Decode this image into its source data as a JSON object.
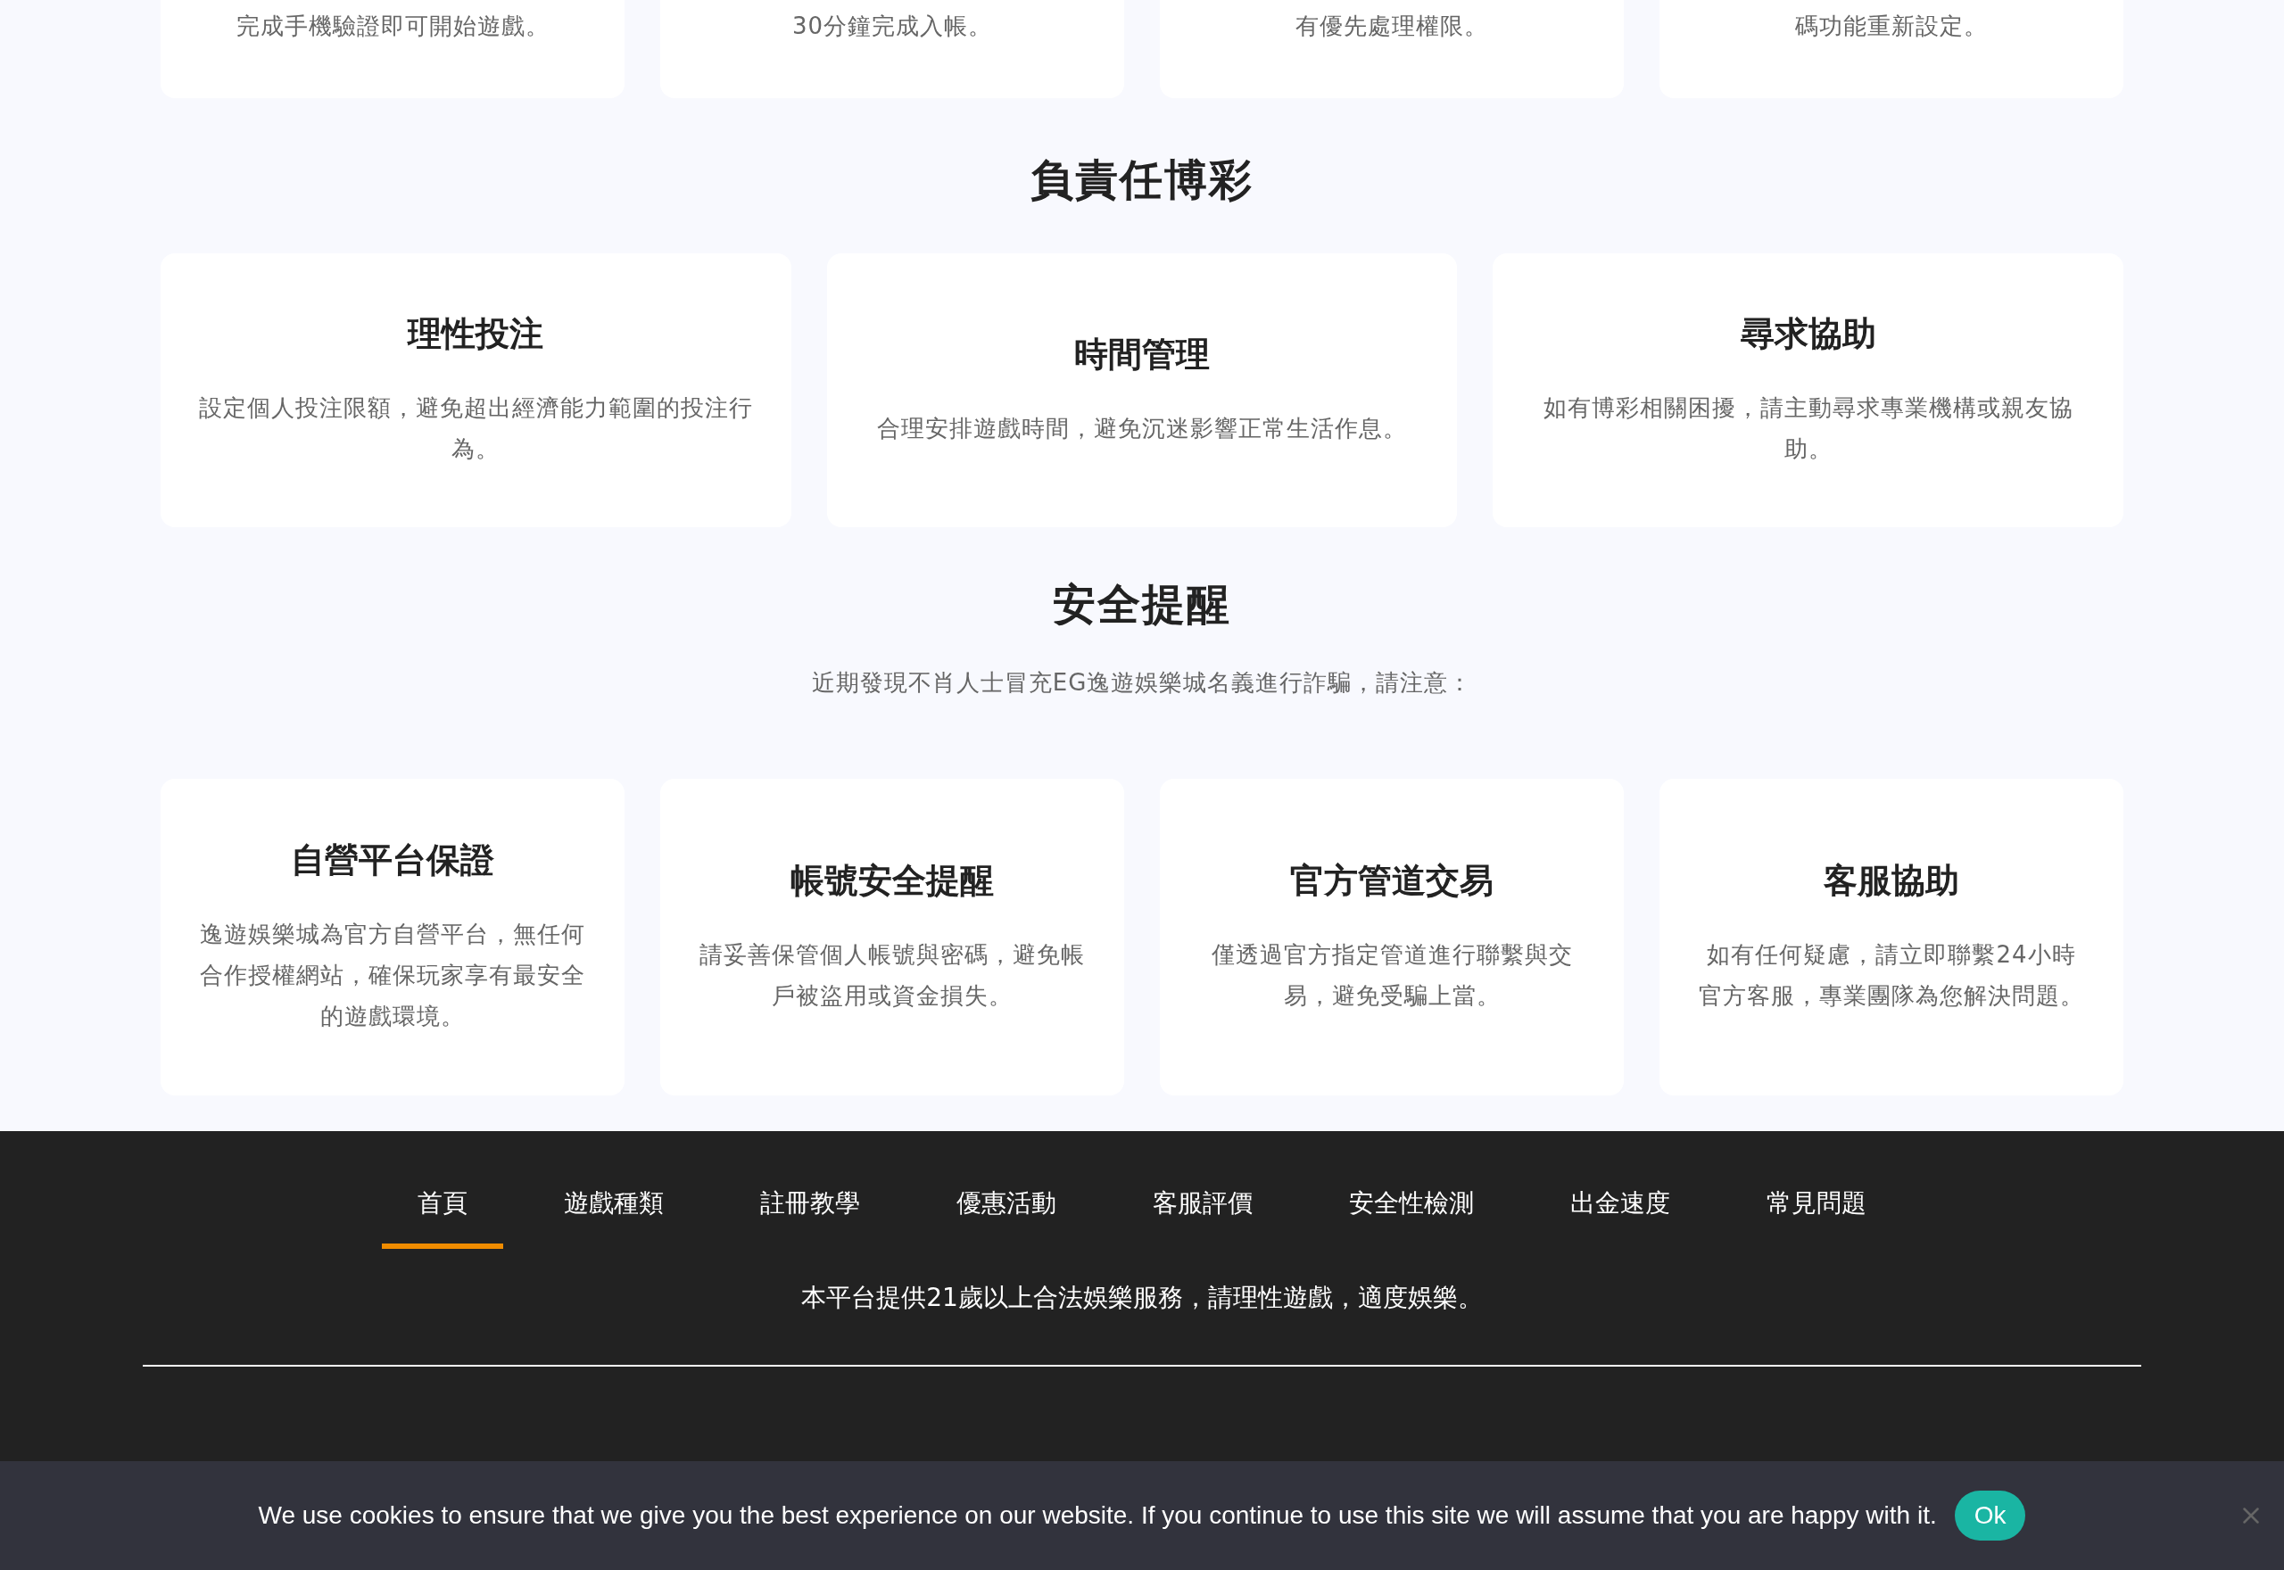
{
  "top_cards": [
    {
      "text": "完成手機驗證即可開始遊戲。"
    },
    {
      "text": "30分鐘完成入帳。"
    },
    {
      "text": "有優先處理權限。"
    },
    {
      "text": "碼功能重新設定。"
    }
  ],
  "responsible": {
    "title": "負責任博彩",
    "cards": [
      {
        "title": "理性投注",
        "text": "設定個人投注限額，避免超出經濟能力範圍的投注行為。"
      },
      {
        "title": "時間管理",
        "text": "合理安排遊戲時間，避免沉迷影響正常生活作息。"
      },
      {
        "title": "尋求協助",
        "text": "如有博彩相關困擾，請主動尋求專業機構或親友協助。"
      }
    ]
  },
  "safety": {
    "title": "安全提醒",
    "subtitle": "近期發現不肖人士冒充EG逸遊娛樂城名義進行詐騙，請注意：",
    "cards": [
      {
        "title": "自營平台保證",
        "text": "逸遊娛樂城為官方自營平台，無任何合作授權網站，確保玩家享有最安全的遊戲環境。"
      },
      {
        "title": "帳號安全提醒",
        "text": "請妥善保管個人帳號與密碼，避免帳戶被盜用或資金損失。"
      },
      {
        "title": "官方管道交易",
        "text": "僅透過官方指定管道進行聯繫與交易，避免受騙上當。"
      },
      {
        "title": "客服協助",
        "text": "如有任何疑慮，請立即聯繫24小時官方客服，專業團隊為您解決問題。"
      }
    ]
  },
  "footer": {
    "nav": [
      {
        "label": "首頁",
        "selected": true
      },
      {
        "label": "遊戲種類",
        "selected": false
      },
      {
        "label": "註冊教學",
        "selected": false
      },
      {
        "label": "優惠活動",
        "selected": false
      },
      {
        "label": "客服評價",
        "selected": false
      },
      {
        "label": "安全性檢測",
        "selected": false
      },
      {
        "label": "出金速度",
        "selected": false
      },
      {
        "label": "常見問題",
        "selected": false
      }
    ],
    "disclaimer": "本平台提供21歲以上合法娛樂服務，請理性遊戲，適度娛樂。"
  },
  "cookie_bar": {
    "text": "We use cookies to ensure that we give you the best experience on our website. If you continue to use this site we will assume that you are happy with it.",
    "button": "Ok"
  }
}
